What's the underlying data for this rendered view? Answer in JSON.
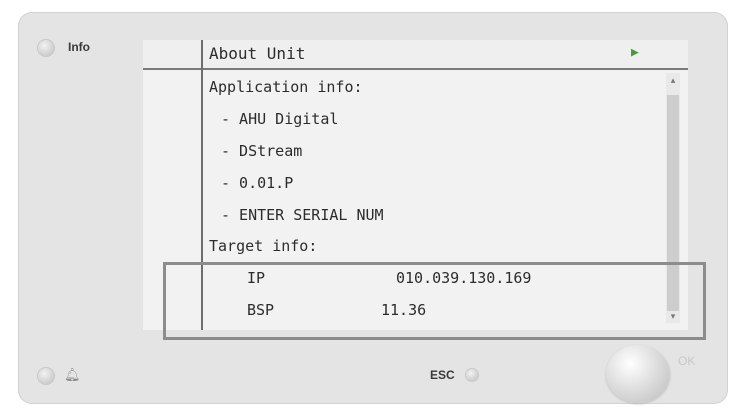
{
  "device": {
    "info_label": "Info",
    "esc_label": "ESC",
    "ok_label": "OK",
    "bell_icon": "bell-icon"
  },
  "screen": {
    "title": "About Unit",
    "lines": [
      "Application info:",
      "- AHU Digital",
      "- DStream",
      "- 0.01.P",
      "- ENTER SERIAL NUM",
      "Target info:"
    ],
    "target": {
      "ip_label": "IP",
      "ip_value": "010.039.130.169",
      "bsp_label": "BSP",
      "bsp_value": "11.36"
    }
  },
  "colors": {
    "accent_arrow": "#4a9a3a",
    "panel": "#e4e4e4",
    "lcd": "#f2f2f2"
  }
}
